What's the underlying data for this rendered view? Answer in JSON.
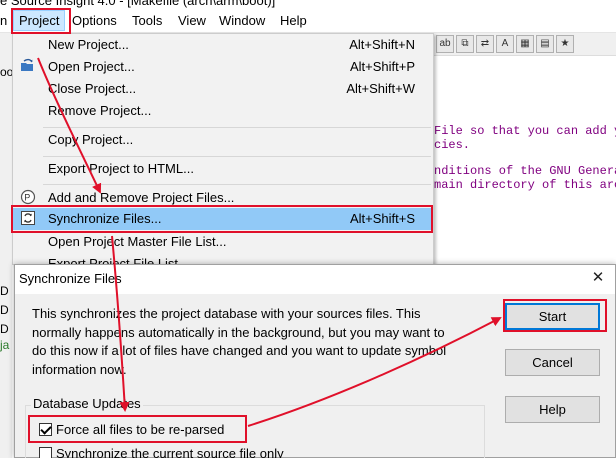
{
  "window": {
    "title": "e Source Insight 4.0 - [Makefile (arch\\arm\\boot)]"
  },
  "menubar": {
    "items": [
      "n",
      "Project",
      "Options",
      "Tools",
      "View",
      "Window",
      "Help"
    ]
  },
  "left_pane": {
    "labels": [
      "oo",
      "D",
      "D",
      "D",
      "ja"
    ]
  },
  "toolbar": {
    "icons": [
      "abc-icon",
      "copy-icon",
      "arrows-icon",
      "a-icon",
      "grid-icon",
      "book-icon",
      "star-icon",
      "lock-icon",
      "function-icon",
      "table-icon",
      "fx-icon"
    ]
  },
  "editor": {
    "lines": [
      "File so that you can add y",
      "cies.",
      "nditions of the GNU Genera",
      "main directory of this arc"
    ]
  },
  "project_menu": {
    "items": [
      {
        "label": "New Project...",
        "accel": "Alt+Shift+N",
        "icon": ""
      },
      {
        "label": "Open Project...",
        "accel": "Alt+Shift+P",
        "icon": "open-folder-icon"
      },
      {
        "label": "Close Project...",
        "accel": "Alt+Shift+W",
        "icon": ""
      },
      {
        "label": "Remove Project...",
        "accel": "",
        "icon": ""
      },
      {
        "label": "Copy Project...",
        "accel": "",
        "icon": ""
      },
      {
        "label": "Export Project to HTML...",
        "accel": "",
        "icon": ""
      },
      {
        "label": "Add and Remove Project Files...",
        "accel": "",
        "icon": "add-files-icon"
      },
      {
        "label": "Synchronize Files...",
        "accel": "Alt+Shift+S",
        "icon": "sync-icon"
      },
      {
        "label": "Open Project Master File List...",
        "accel": "",
        "icon": ""
      },
      {
        "label": "Export Project File List",
        "accel": "",
        "icon": ""
      }
    ]
  },
  "dialog": {
    "title": "Synchronize Files",
    "close_label": "✕",
    "body": "This synchronizes the project database with your sources files. This normally happens automatically in the background, but you may want to do this now if a lot of files have changed and you want to update symbol information now.",
    "buttons": {
      "start": "Start",
      "cancel": "Cancel",
      "help": "Help"
    },
    "group_label": "Database Updates",
    "checkboxes": [
      {
        "label": "Force all files to be re-parsed",
        "checked": true
      },
      {
        "label": "Synchronize the current source file only",
        "checked": false
      }
    ]
  },
  "colors": {
    "annotation_red": "#e0102a",
    "highlight": "#91c9f7",
    "editor_text": "#800080",
    "default_button_border": "#0078d7"
  }
}
